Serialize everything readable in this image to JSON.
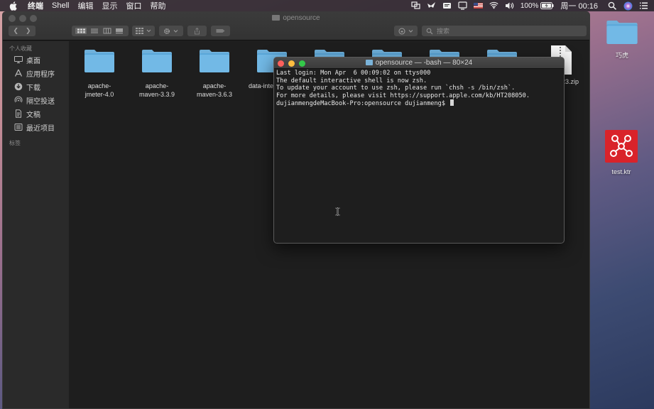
{
  "menubar": {
    "app_name": "终端",
    "items": [
      "Shell",
      "编辑",
      "显示",
      "窗口",
      "帮助"
    ],
    "battery": "100%",
    "clock": "周一 00:16"
  },
  "finder": {
    "title": "opensource",
    "search_placeholder": "搜索",
    "sidebar": {
      "favorites_heading": "个人收藏",
      "items": [
        {
          "label": "桌面",
          "icon": "desktop-icon"
        },
        {
          "label": "应用程序",
          "icon": "applications-icon"
        },
        {
          "label": "下载",
          "icon": "downloads-icon"
        },
        {
          "label": "隔空投送",
          "icon": "airdrop-icon"
        },
        {
          "label": "文稿",
          "icon": "documents-icon"
        },
        {
          "label": "最近项目",
          "icon": "recents-icon"
        }
      ],
      "tags_heading": "标签"
    },
    "files": [
      {
        "line1": "apache-",
        "line2": "jmeter-4.0"
      },
      {
        "line1": "apache-",
        "line2": "maven-3.3.9"
      },
      {
        "line1": "apache-",
        "line2": "maven-3.6.3"
      },
      {
        "line1": "data-inte",
        "line2": ""
      },
      {
        "line1": "",
        "line2": ""
      },
      {
        "line1": "",
        "line2": ""
      },
      {
        "line1": "",
        "line2": ""
      },
      {
        "line1": "",
        "line2": ""
      },
      {
        "line1": "23.zip",
        "line2": ""
      }
    ]
  },
  "terminal": {
    "title": "opensource — -bash — 80×24",
    "lines": [
      "Last login: Mon Apr  6 00:09:02 on ttys000",
      "",
      "The default interactive shell is now zsh.",
      "To update your account to use zsh, please run `chsh -s /bin/zsh`.",
      "For more details, please visit https://support.apple.com/kb/HT208050."
    ],
    "prompt": "dujianmengdeMacBook-Pro:opensource dujianmeng$ "
  },
  "desktop": {
    "icons": [
      {
        "label": "巧虎",
        "icon": "folder-icon"
      },
      {
        "label": "test.ktr",
        "icon": "kettle-file-icon"
      }
    ]
  }
}
